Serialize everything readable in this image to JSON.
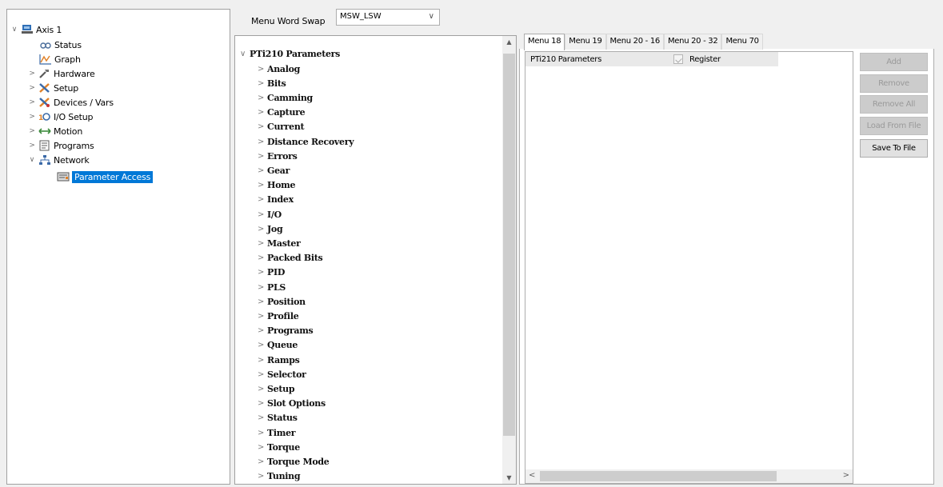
{
  "nav": {
    "root": "Axis 1",
    "items": [
      {
        "label": "Status",
        "icon": "status-icon"
      },
      {
        "label": "Graph",
        "icon": "graph-icon"
      },
      {
        "label": "Hardware",
        "icon": "hardware-icon"
      },
      {
        "label": "Setup",
        "icon": "setup-icon"
      },
      {
        "label": "Devices / Vars",
        "icon": "devices-icon"
      },
      {
        "label": "I/O Setup",
        "icon": "io-setup-icon"
      },
      {
        "label": "Motion",
        "icon": "motion-icon"
      },
      {
        "label": "Programs",
        "icon": "programs-icon"
      },
      {
        "label": "Network",
        "icon": "network-icon"
      },
      {
        "label": "Parameter Access",
        "icon": "parameter-access-icon"
      }
    ]
  },
  "toolbar": {
    "swap_label": "Menu Word Swap",
    "swap_value": "MSW_LSW"
  },
  "params": {
    "root": "PTi210 Parameters",
    "items": [
      "Analog",
      "Bits",
      "Camming",
      "Capture",
      "Current",
      "Distance Recovery",
      "Errors",
      "Gear",
      "Home",
      "Index",
      "I/O",
      "Jog",
      "Master",
      "Packed Bits",
      "PID",
      "PLS",
      "Position",
      "Profile",
      "Programs",
      "Queue",
      "Ramps",
      "Selector",
      "Setup",
      "Slot Options",
      "Status",
      "Timer",
      "Torque",
      "Torque Mode",
      "Tuning"
    ]
  },
  "tabs": [
    "Menu 18",
    "Menu 19",
    "Menu 20 - 16",
    "Menu 20 - 32",
    "Menu 70"
  ],
  "grid": {
    "col_name": "PTi210 Parameters",
    "col_register": "Register"
  },
  "buttons": {
    "add": "Add",
    "remove": "Remove",
    "remove_all": "Remove All",
    "load": "Load From File",
    "save": "Save To File"
  },
  "colors": {
    "selection": "#0078d7"
  }
}
